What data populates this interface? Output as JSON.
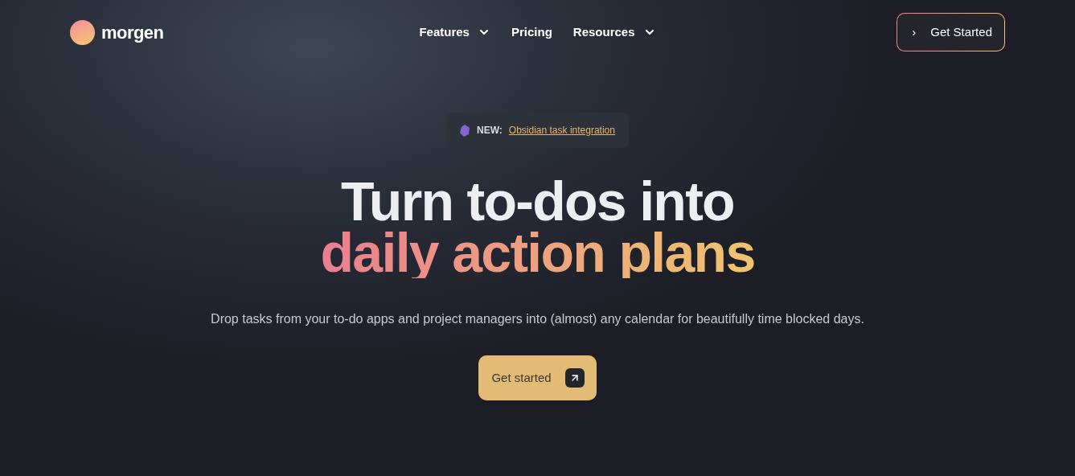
{
  "logo": {
    "name": "morgen"
  },
  "nav": [
    {
      "label": "Features",
      "dropdown": true
    },
    {
      "label": "Pricing",
      "dropdown": false
    },
    {
      "label": "Resources",
      "dropdown": true
    }
  ],
  "header_button": {
    "icon": "›",
    "label": "Get Started"
  },
  "announcement": {
    "prefix": "NEW:",
    "link": "Obsidian task integration"
  },
  "headline": {
    "line_1": "Turn to-dos into",
    "line_2": "daily action plans"
  },
  "subtitle": "Drop tasks from your to-do apps and project managers into (almost) any calendar for beautifully time blocked days.",
  "cta": {
    "label": "Get started"
  }
}
